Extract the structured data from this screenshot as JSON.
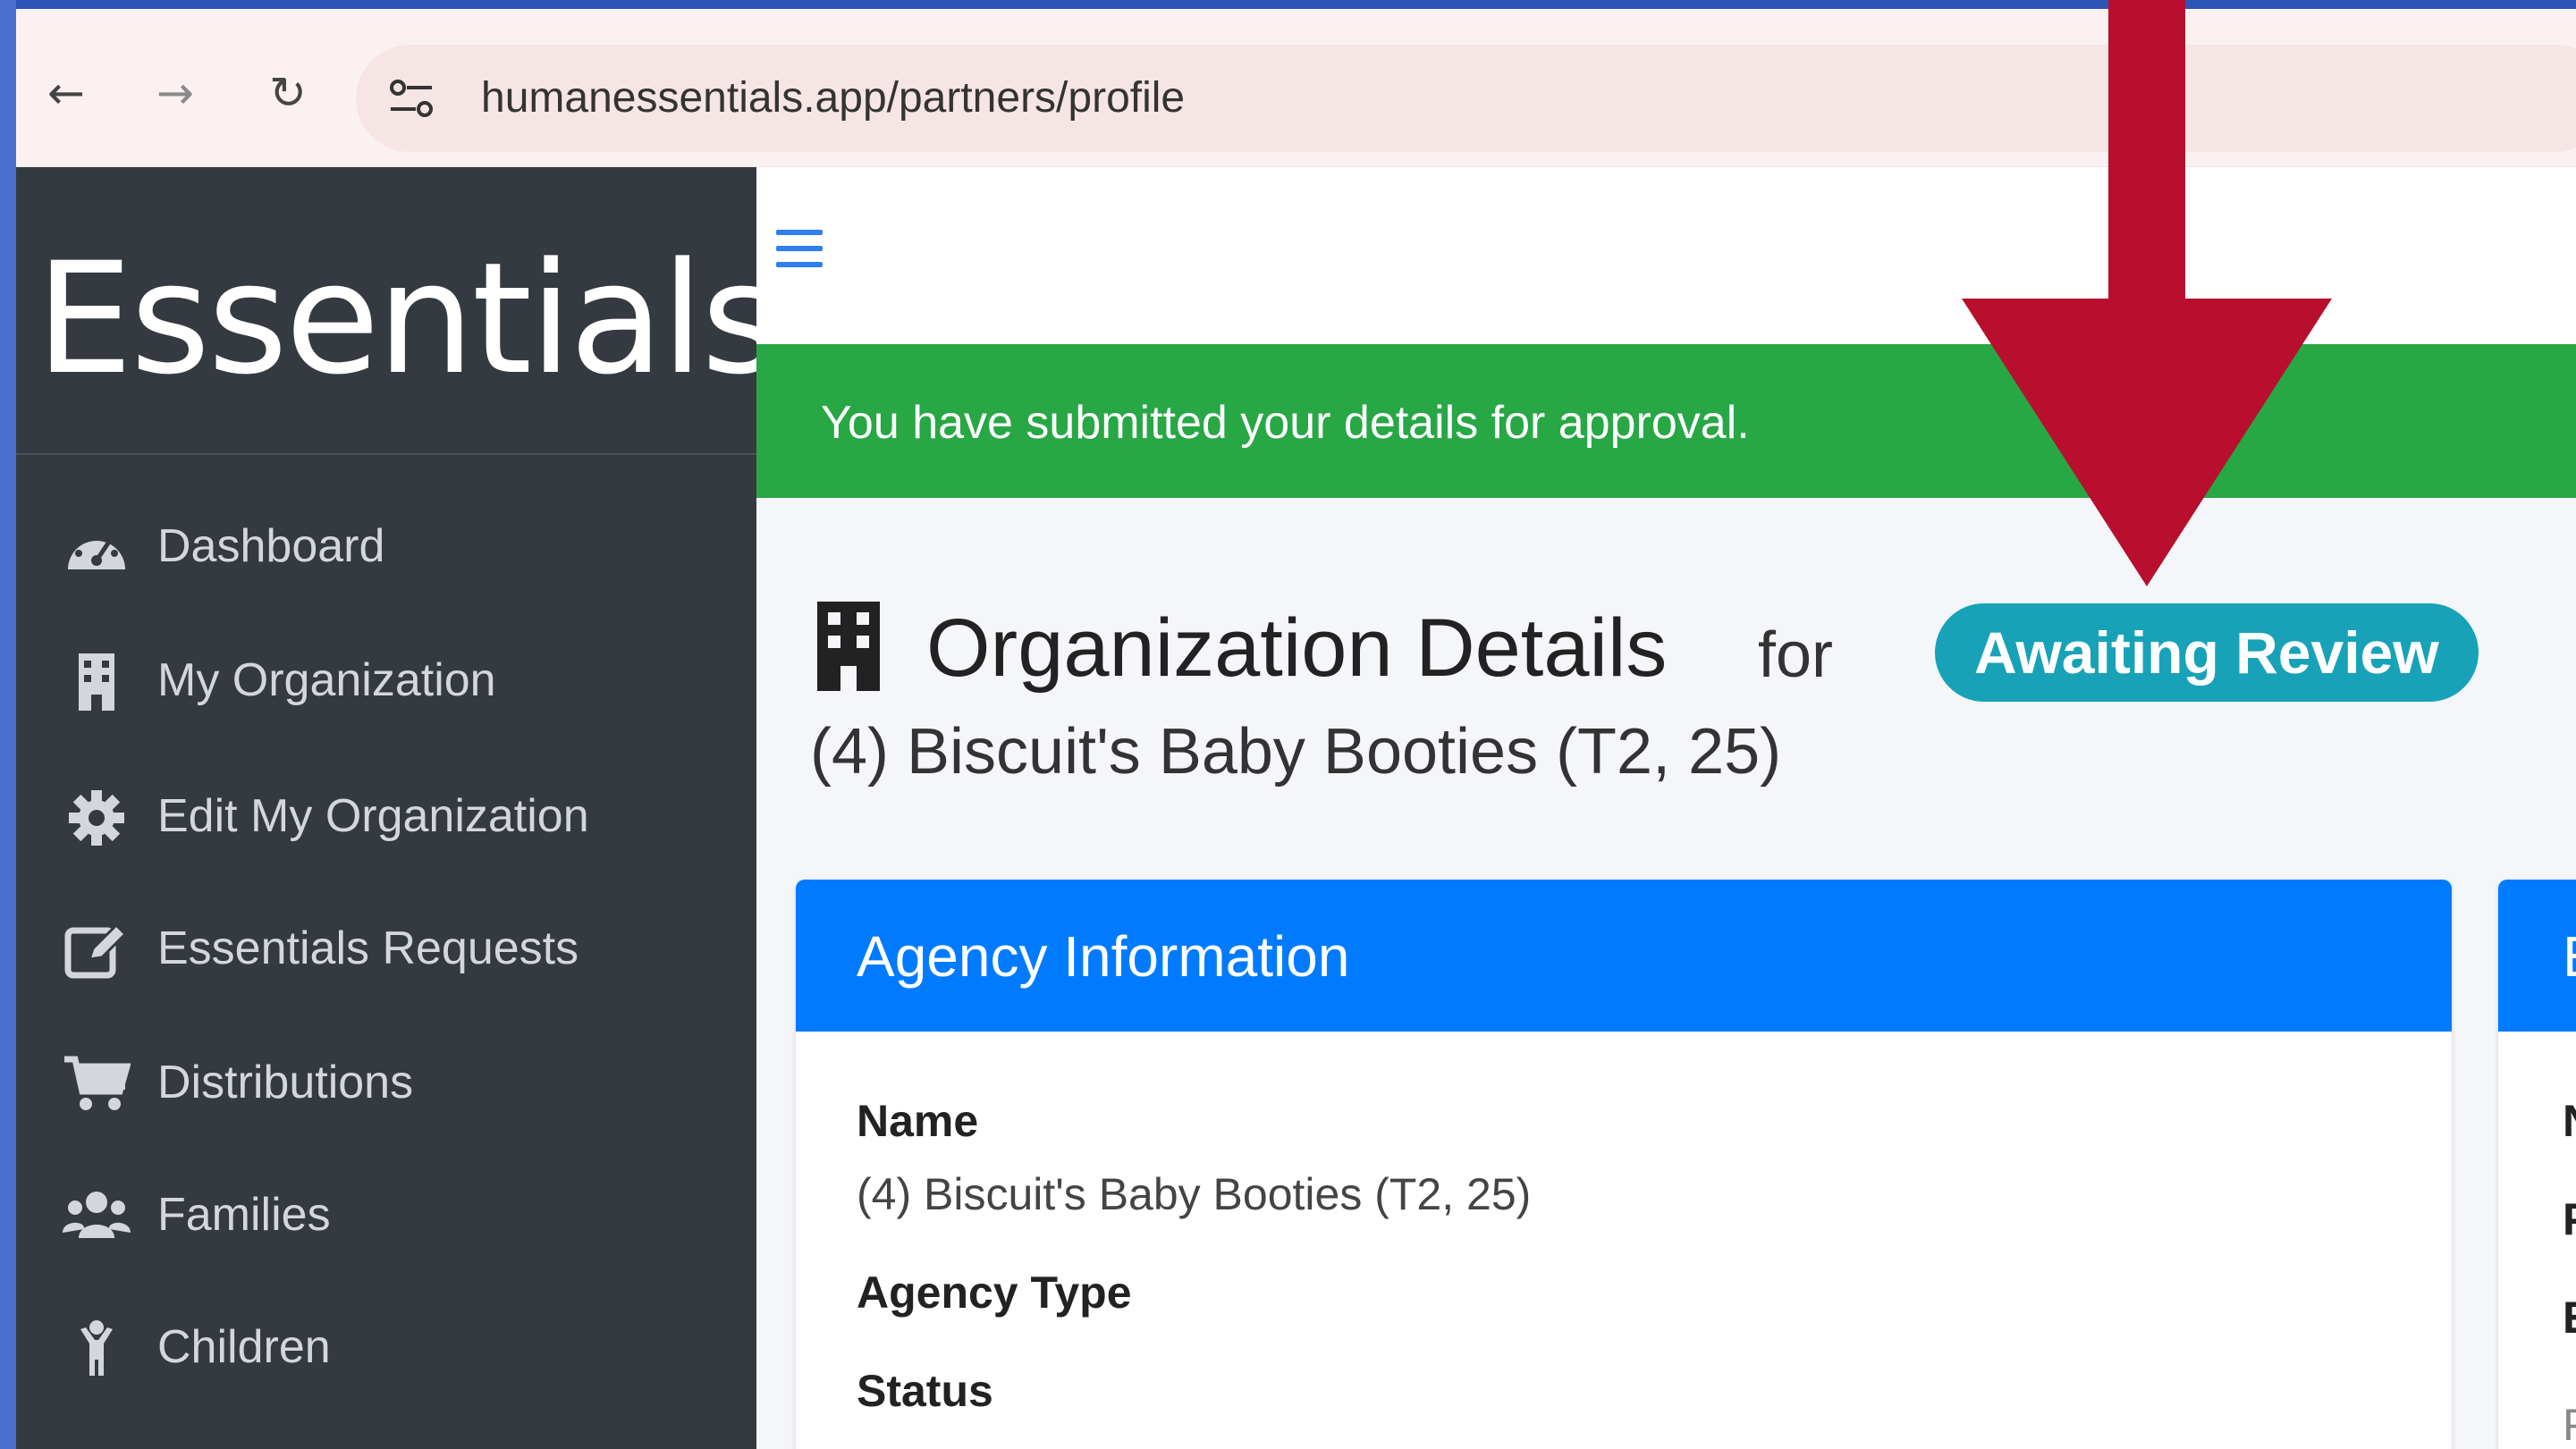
{
  "browser": {
    "url": "humanessentials.app/partners/profile"
  },
  "sidebar": {
    "brand": "Essentials",
    "items": [
      {
        "label": "Dashboard",
        "icon": "tachometer-icon"
      },
      {
        "label": "My Organization",
        "icon": "building-icon"
      },
      {
        "label": "Edit My Organization",
        "icon": "gear-icon"
      },
      {
        "label": "Essentials Requests",
        "icon": "edit-icon"
      },
      {
        "label": "Distributions",
        "icon": "shopping-cart-icon"
      },
      {
        "label": "Families",
        "icon": "users-icon"
      },
      {
        "label": "Children",
        "icon": "child-icon"
      }
    ]
  },
  "alert": {
    "message": "You have submitted your details for approval."
  },
  "header": {
    "title": "Organization Details",
    "for_label": "for",
    "status": "Awaiting Review",
    "organization": "(4) Biscuit's Baby Booties (T2, 25)"
  },
  "agency_card": {
    "title": "Agency Information",
    "fields": [
      {
        "label": "Name",
        "value": "(4) Biscuit's Baby Booties (T2, 25)"
      },
      {
        "label": "Agency Type",
        "value": ""
      },
      {
        "label": "Status",
        "value": ""
      }
    ]
  },
  "second_card": {
    "title_fragment": "E",
    "label_fragments": [
      "N",
      "P",
      "E",
      "P"
    ]
  },
  "colors": {
    "sidebar_bg": "#343a40",
    "alert_green": "#28a745",
    "card_header_blue": "#007bff",
    "badge_teal": "#17a2b8",
    "arrow_red": "#b80f2e"
  }
}
